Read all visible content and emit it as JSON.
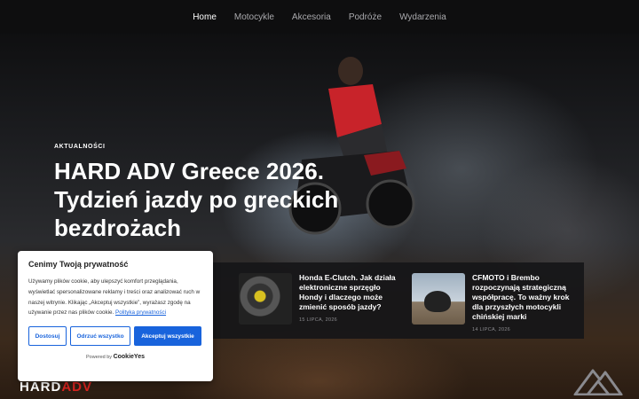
{
  "nav": {
    "items": [
      {
        "label": "Home",
        "active": true
      },
      {
        "label": "Motocykle"
      },
      {
        "label": "Akcesoria"
      },
      {
        "label": "Podróże"
      },
      {
        "label": "Wydarzenia"
      }
    ]
  },
  "hero": {
    "kicker": "AKTUALNOŚCI",
    "title": "HARD ADV Greece 2026. Tydzień jazdy po greckich bezdrożach"
  },
  "news": {
    "partial_fragment": "6",
    "cards": [
      {
        "title": "Honda E-Clutch. Jak działa elektroniczne sprzęgło Hondy i dlaczego może zmienić sposób jazdy?",
        "date": "15 LIPCA, 2026"
      },
      {
        "title": "CFMOTO i Brembo rozpoczynają strategiczną współpracę. To ważny krok dla przyszłych motocykli chińskiej marki",
        "date": "14 LIPCA, 2026"
      }
    ]
  },
  "footer_logo": {
    "part1": "HARD",
    "part2": "ADV"
  },
  "cookie": {
    "title": "Cenimy Twoją prywatność",
    "text": "Używamy plików cookie, aby ulepszyć komfort przeglądania, wyświetlać spersonalizowane reklamy i treści oraz analizować ruch w naszej witrynie. Klikając „Akceptuj wszystkie”, wyrażasz zgodę na używanie przez nas plików cookie.",
    "policy_link": "Polityka prywatności",
    "buttons": {
      "customize": "Dostosuj",
      "reject": "Odrzuć wszystko",
      "accept": "Akceptuj wszystkie"
    },
    "powered_prefix": "Powered by",
    "powered_brand": "CookieYes"
  },
  "colors": {
    "accent": "#1863dc",
    "logo_red": "#d6231f",
    "nav_bg": "#0e0e0f"
  }
}
